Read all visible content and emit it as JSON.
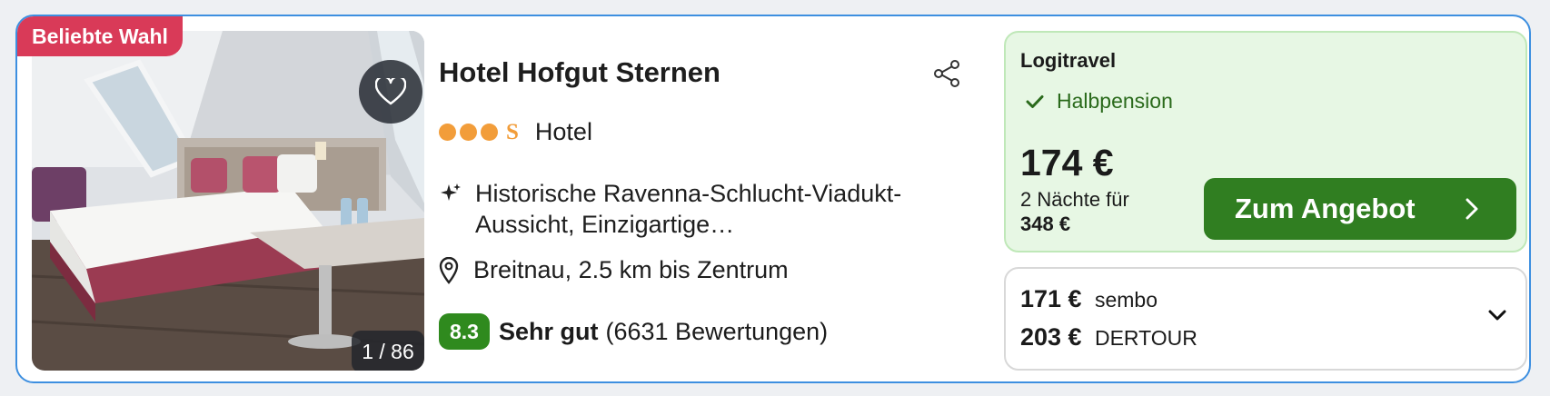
{
  "hotel": {
    "badge": "Beliebte Wahl",
    "photo_counter": "1 / 86",
    "name": "Hotel Hofgut Sternen",
    "stars": 3,
    "star_suffix": "S",
    "type": "Hotel",
    "feature": "Historische Ravenna-Schlucht-Viadukt-Aussicht, Einzigartige…",
    "location": "Breitnau, 2.5 km bis Zentrum",
    "rating": {
      "score": "8.3",
      "label": "Sehr gut",
      "reviews": "(6631 Bewertungen)"
    }
  },
  "best_offer": {
    "provider": "Logitravel",
    "board": "Halbpension",
    "price": "174 €",
    "nights_text": "2 Nächte für",
    "total": "348 €",
    "cta_label": "Zum Angebot"
  },
  "other_offers": [
    {
      "price": "171 €",
      "provider": "sembo"
    },
    {
      "price": "203 €",
      "provider": "DERTOUR"
    }
  ],
  "colors": {
    "badge": "#d93a58",
    "accent_border": "#3d8fe0",
    "stars": "#f29d3a",
    "rating_bg": "#2f8a1e",
    "offer_bg": "#e7f7e4",
    "cta_bg": "#307e21"
  },
  "icons": {
    "favorite": "heart-icon",
    "share": "share-icon",
    "feature": "sparkles-icon",
    "location": "map-pin-icon",
    "board": "check-icon",
    "cta": "chevron-right-icon",
    "expand": "chevron-down-icon"
  }
}
